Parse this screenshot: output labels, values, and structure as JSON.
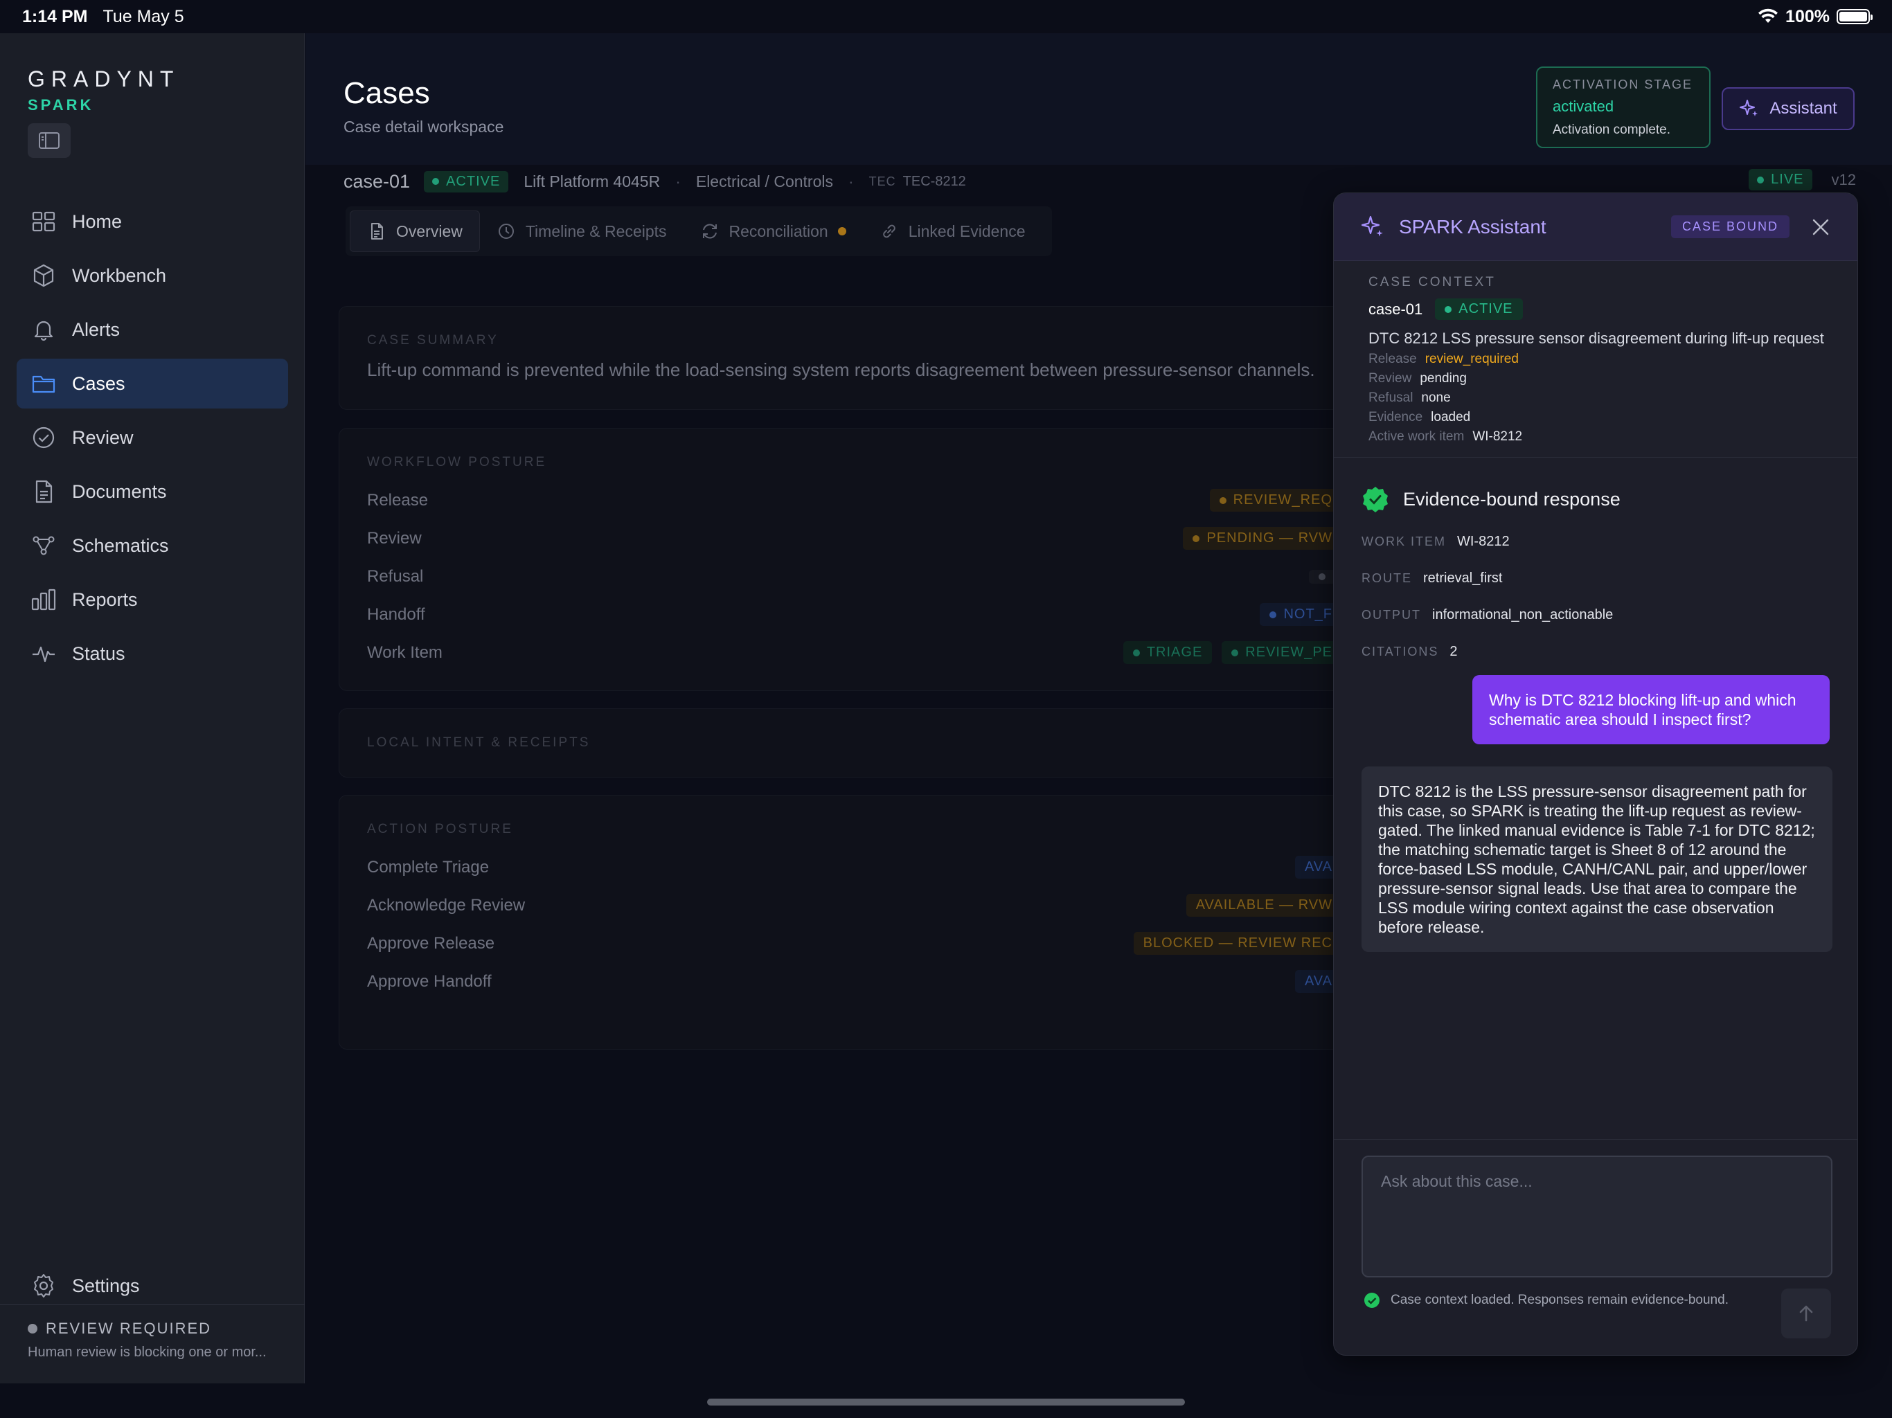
{
  "status_bar": {
    "time": "1:14 PM",
    "date": "Tue May 5",
    "battery": "100%"
  },
  "brand": {
    "name": "GRADYNT",
    "product": "SPARK"
  },
  "nav": {
    "items": [
      {
        "id": "home",
        "label": "Home",
        "icon": "grid-icon"
      },
      {
        "id": "workbench",
        "label": "Workbench",
        "icon": "cube-icon"
      },
      {
        "id": "alerts",
        "label": "Alerts",
        "icon": "bell-icon"
      },
      {
        "id": "cases",
        "label": "Cases",
        "icon": "folder-icon",
        "active": true
      },
      {
        "id": "review",
        "label": "Review",
        "icon": "check-circle-icon"
      },
      {
        "id": "documents",
        "label": "Documents",
        "icon": "document-icon"
      },
      {
        "id": "schematics",
        "label": "Schematics",
        "icon": "nodes-icon"
      },
      {
        "id": "reports",
        "label": "Reports",
        "icon": "bar-chart-icon"
      },
      {
        "id": "status",
        "label": "Status",
        "icon": "pulse-icon"
      }
    ],
    "settings": "Settings"
  },
  "review_required": {
    "label": "REVIEW REQUIRED",
    "desc": "Human review is blocking one or mor..."
  },
  "header": {
    "title": "Cases",
    "subtitle": "Case detail workspace",
    "activation": {
      "caption": "ACTIVATION STAGE",
      "value": "activated",
      "note": "Activation complete."
    },
    "assistant_button": "Assistant"
  },
  "case": {
    "id": "case-01",
    "status": "ACTIVE",
    "asset": "Lift Platform 4045R",
    "system": "Electrical / Controls",
    "tec_caption": "TEC",
    "tec": "TEC-8212",
    "live": "LIVE",
    "version": "v12"
  },
  "tabs": [
    {
      "label": "Overview",
      "icon": "document-icon",
      "active": true
    },
    {
      "label": "Timeline & Receipts",
      "icon": "clock-icon"
    },
    {
      "label": "Reconciliation",
      "icon": "sync-icon",
      "dot": true
    },
    {
      "label": "Linked Evidence",
      "icon": "link-icon"
    }
  ],
  "summary": {
    "caption": "CASE SUMMARY",
    "text": "Lift-up command is prevented while the load-sensing system reports disagreement between pressure-sensor channels."
  },
  "workflow": {
    "caption": "WORKFLOW POSTURE",
    "rows": [
      {
        "label": "Release",
        "badges": [
          {
            "text": "REVIEW_REQ",
            "tone": "amber"
          }
        ]
      },
      {
        "label": "Review",
        "badges": [
          {
            "text": "PENDING — RVW",
            "tone": "amber"
          }
        ]
      },
      {
        "label": "Refusal",
        "badges": [
          {
            "text": "",
            "tone": "grey"
          }
        ]
      },
      {
        "label": "Handoff",
        "badges": [
          {
            "text": "NOT_F",
            "tone": "blue"
          }
        ]
      },
      {
        "label": "Work Item",
        "badges": [
          {
            "text": "TRIAGE",
            "tone": "green"
          },
          {
            "text": "REVIEW_PE",
            "tone": "green"
          }
        ]
      }
    ]
  },
  "intent": {
    "caption": "LOCAL INTENT & RECEIPTS"
  },
  "action": {
    "caption": "ACTION POSTURE",
    "rows": [
      {
        "label": "Complete Triage",
        "badge": "AVA",
        "tone": "blue"
      },
      {
        "label": "Acknowledge Review",
        "badge": "AVAILABLE — RVW",
        "tone": "amber"
      },
      {
        "label": "Approve Release",
        "badge": "BLOCKED — REVIEW REC",
        "tone": "amber"
      },
      {
        "label": "Approve Handoff",
        "badge": "AVA",
        "tone": "blue"
      }
    ]
  },
  "assistant": {
    "title": "SPARK Assistant",
    "bound_badge": "CASE BOUND",
    "context": {
      "caption": "CASE CONTEXT",
      "case_id": "case-01",
      "status": "ACTIVE",
      "description": "DTC 8212 LSS pressure sensor disagreement during lift-up request",
      "fields": [
        {
          "key": "Release",
          "value": "review_required",
          "warn": true
        },
        {
          "key": "Review",
          "value": "pending"
        },
        {
          "key": "Refusal",
          "value": "none"
        },
        {
          "key": "Evidence",
          "value": "loaded"
        },
        {
          "key": "Active work item",
          "value": "WI-8212"
        }
      ]
    },
    "response": {
      "title": "Evidence-bound response",
      "meta": [
        {
          "key": "WORK ITEM",
          "value": "WI-8212"
        },
        {
          "key": "ROUTE",
          "value": "retrieval_first"
        },
        {
          "key": "OUTPUT",
          "value": "informational_non_actionable"
        },
        {
          "key": "CITATIONS",
          "value": "2"
        }
      ]
    },
    "user_message": "Why is DTC 8212 blocking lift-up and which schematic area should I inspect first?",
    "bot_message": "DTC 8212 is the LSS pressure-sensor disagreement path for this case, so SPARK is treating the lift-up request as review-gated. The linked manual evidence is Table 7-1 for DTC 8212; the matching schematic target is Sheet 8 of 12 around the force-based LSS module, CANH/CANL pair, and upper/lower pressure-sensor signal leads. Use that area to compare the LSS module wiring context against the case observation before release.",
    "input_placeholder": "Ask about this case...",
    "context_note": "Case context loaded. Responses remain evidence-bound."
  },
  "colors": {
    "accent": "#7c3aed",
    "success": "#2dd4a7",
    "warning": "#f0a91d",
    "info": "#3d6bc9"
  }
}
